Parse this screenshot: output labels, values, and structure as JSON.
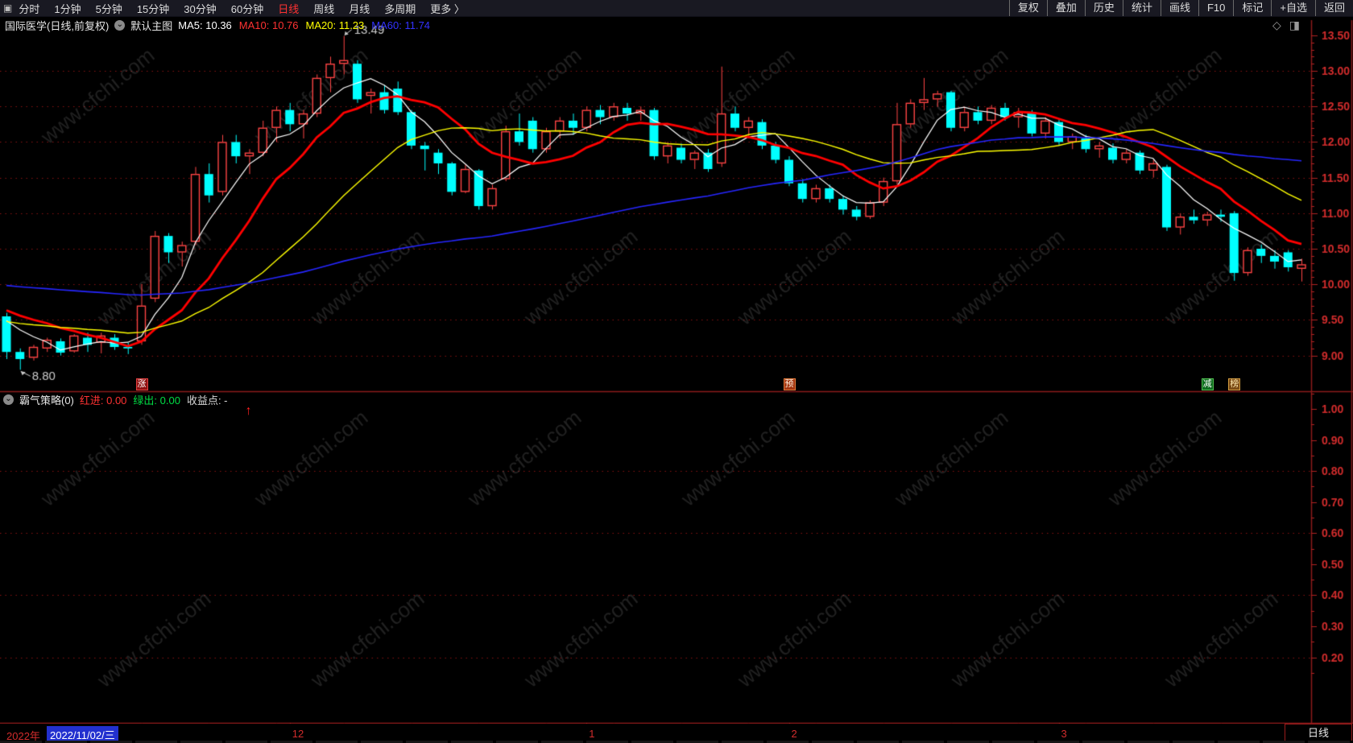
{
  "topbar": {
    "window_icon": "▣",
    "periods": [
      {
        "label": "分时",
        "active": false
      },
      {
        "label": "1分钟",
        "active": false
      },
      {
        "label": "5分钟",
        "active": false
      },
      {
        "label": "15分钟",
        "active": false
      },
      {
        "label": "30分钟",
        "active": false
      },
      {
        "label": "60分钟",
        "active": false
      },
      {
        "label": "日线",
        "active": true
      },
      {
        "label": "周线",
        "active": false
      },
      {
        "label": "月线",
        "active": false
      },
      {
        "label": "多周期",
        "active": false
      },
      {
        "label": "更多 〉",
        "active": false
      }
    ],
    "tools": [
      "复权",
      "叠加",
      "历史",
      "统计",
      "画线",
      "F10",
      "标记",
      "+自选",
      "返回"
    ]
  },
  "title_bar": {
    "stock": "国际医学(日线,前复权)",
    "toggle_icon": "⌄",
    "overlay_label": "默认主图",
    "ma_labels": [
      {
        "text": "MA5: 10.36",
        "color": "#ffffff"
      },
      {
        "text": "MA10: 10.76",
        "color": "#ff3232"
      },
      {
        "text": "MA20: 11.23",
        "color": "#ffff00"
      },
      {
        "text": "MA60: 11.74",
        "color": "#3232ff"
      }
    ],
    "diamond_icon": "◇",
    "split_icon": "◨"
  },
  "indicator_bar": {
    "toggle_icon": "⌄",
    "name": "霸气策略(0)",
    "items": [
      {
        "text": "红进: 0.00",
        "color": "#ff3232"
      },
      {
        "text": "绿出: 0.00",
        "color": "#00dd44"
      },
      {
        "text": "收益点: -",
        "color": "#d8d8d8"
      }
    ]
  },
  "chart_data": {
    "type": "candlestick",
    "title": "国际医学(日线,前复权)",
    "period": "日线",
    "watermark_text": "www.cfchi.com",
    "y_axis_main": {
      "ticks": [
        13.5,
        13.0,
        12.5,
        12.0,
        11.5,
        11.0,
        10.5,
        10.0,
        9.5,
        9.0
      ],
      "grid_lines": [
        13.0,
        12.5,
        12.0,
        11.5,
        11.0,
        10.5,
        10.0,
        9.5,
        9.0
      ]
    },
    "y_axis_sub": {
      "ticks": [
        1.0,
        0.9,
        0.8,
        0.7,
        0.6,
        0.5,
        0.4,
        0.3,
        0.2
      ],
      "grid_lines": [
        0.8,
        0.6,
        0.4,
        0.2
      ]
    },
    "x_axis": {
      "year_label": "2022年",
      "selected_date": "2022/11/02/三",
      "month_ticks": [
        {
          "label": "12",
          "index": 21
        },
        {
          "label": "1",
          "index": 43
        },
        {
          "label": "2",
          "index": 58
        },
        {
          "label": "3",
          "index": 78
        }
      ],
      "period_label": "日线"
    },
    "candles": [
      [
        9.55,
        9.6,
        8.95,
        9.05
      ],
      [
        9.05,
        9.1,
        8.8,
        8.95
      ],
      [
        8.97,
        9.15,
        8.93,
        9.12
      ],
      [
        9.1,
        9.25,
        9.05,
        9.22
      ],
      [
        9.2,
        9.24,
        9.0,
        9.04
      ],
      [
        9.06,
        9.3,
        9.04,
        9.28
      ],
      [
        9.25,
        9.32,
        9.05,
        9.15
      ],
      [
        9.18,
        9.32,
        9.03,
        9.28
      ],
      [
        9.25,
        9.3,
        9.08,
        9.12
      ],
      [
        9.12,
        9.18,
        9.02,
        9.1
      ],
      [
        9.2,
        10.0,
        9.15,
        9.7
      ],
      [
        9.8,
        10.75,
        9.75,
        10.68
      ],
      [
        10.68,
        10.72,
        10.3,
        10.45
      ],
      [
        10.45,
        10.6,
        10.25,
        10.55
      ],
      [
        10.6,
        11.65,
        10.55,
        11.55
      ],
      [
        11.55,
        11.7,
        11.15,
        11.25
      ],
      [
        11.3,
        12.1,
        11.25,
        12.0
      ],
      [
        12.0,
        12.1,
        11.7,
        11.8
      ],
      [
        11.8,
        11.9,
        11.55,
        11.85
      ],
      [
        11.85,
        12.3,
        11.8,
        12.2
      ],
      [
        12.2,
        12.5,
        12.0,
        12.45
      ],
      [
        12.45,
        12.55,
        12.15,
        12.25
      ],
      [
        12.25,
        12.45,
        12.05,
        12.4
      ],
      [
        12.4,
        12.95,
        12.35,
        12.9
      ],
      [
        12.9,
        13.2,
        12.7,
        13.1
      ],
      [
        13.1,
        13.49,
        12.95,
        13.15
      ],
      [
        13.1,
        13.15,
        12.55,
        12.6
      ],
      [
        12.65,
        12.75,
        12.4,
        12.7
      ],
      [
        12.7,
        12.8,
        12.4,
        12.45
      ],
      [
        12.75,
        12.85,
        12.38,
        12.42
      ],
      [
        12.42,
        12.45,
        11.9,
        11.95
      ],
      [
        11.95,
        12.0,
        11.6,
        11.9
      ],
      [
        11.85,
        11.9,
        11.55,
        11.7
      ],
      [
        11.7,
        11.72,
        11.25,
        11.3
      ],
      [
        11.3,
        11.68,
        11.28,
        11.62
      ],
      [
        11.6,
        11.62,
        11.05,
        11.1
      ],
      [
        11.1,
        11.4,
        11.05,
        11.35
      ],
      [
        11.48,
        12.23,
        11.45,
        12.15
      ],
      [
        12.15,
        12.4,
        11.95,
        12.0
      ],
      [
        12.3,
        12.35,
        11.85,
        11.9
      ],
      [
        11.9,
        12.2,
        11.85,
        12.15
      ],
      [
        12.15,
        12.35,
        12.05,
        12.3
      ],
      [
        12.3,
        12.4,
        12.1,
        12.2
      ],
      [
        12.2,
        12.5,
        12.15,
        12.45
      ],
      [
        12.45,
        12.52,
        12.25,
        12.35
      ],
      [
        12.35,
        12.55,
        12.3,
        12.5
      ],
      [
        12.48,
        12.55,
        12.3,
        12.4
      ],
      [
        12.4,
        12.5,
        12.3,
        12.45
      ],
      [
        12.45,
        12.48,
        11.75,
        11.8
      ],
      [
        11.8,
        12.0,
        11.7,
        11.95
      ],
      [
        11.92,
        11.98,
        11.7,
        11.75
      ],
      [
        11.75,
        11.88,
        11.62,
        11.85
      ],
      [
        11.85,
        11.9,
        11.58,
        11.62
      ],
      [
        11.7,
        13.06,
        11.65,
        12.4
      ],
      [
        12.4,
        12.5,
        12.15,
        12.2
      ],
      [
        12.2,
        12.35,
        12.05,
        12.3
      ],
      [
        12.28,
        12.32,
        11.9,
        11.95
      ],
      [
        11.95,
        12.0,
        11.7,
        11.75
      ],
      [
        11.75,
        11.8,
        11.38,
        11.42
      ],
      [
        11.42,
        11.48,
        11.15,
        11.2
      ],
      [
        11.2,
        11.4,
        11.15,
        11.35
      ],
      [
        11.35,
        11.4,
        11.15,
        11.2
      ],
      [
        11.2,
        11.25,
        10.98,
        11.05
      ],
      [
        11.05,
        11.1,
        10.9,
        10.95
      ],
      [
        10.95,
        11.18,
        10.92,
        11.15
      ],
      [
        11.15,
        11.5,
        11.1,
        11.45
      ],
      [
        11.45,
        12.55,
        11.4,
        12.25
      ],
      [
        12.25,
        12.6,
        12.2,
        12.55
      ],
      [
        12.55,
        12.9,
        12.45,
        12.6
      ],
      [
        12.6,
        12.72,
        12.5,
        12.68
      ],
      [
        12.7,
        12.72,
        12.15,
        12.2
      ],
      [
        12.2,
        12.48,
        12.15,
        12.42
      ],
      [
        12.42,
        12.5,
        12.25,
        12.3
      ],
      [
        12.3,
        12.52,
        12.25,
        12.48
      ],
      [
        12.48,
        12.55,
        12.3,
        12.35
      ],
      [
        12.35,
        12.48,
        12.2,
        12.42
      ],
      [
        12.42,
        12.45,
        12.08,
        12.12
      ],
      [
        12.12,
        12.35,
        12.05,
        12.3
      ],
      [
        12.28,
        12.32,
        11.95,
        12.0
      ],
      [
        12.0,
        12.12,
        11.9,
        12.08
      ],
      [
        12.05,
        12.1,
        11.85,
        11.9
      ],
      [
        11.9,
        12.0,
        11.78,
        11.95
      ],
      [
        11.92,
        11.98,
        11.7,
        11.75
      ],
      [
        11.75,
        11.9,
        11.7,
        11.85
      ],
      [
        11.85,
        11.88,
        11.55,
        11.6
      ],
      [
        11.6,
        11.75,
        11.5,
        11.7
      ],
      [
        11.65,
        11.68,
        10.75,
        10.8
      ],
      [
        10.8,
        11.0,
        10.7,
        10.95
      ],
      [
        10.95,
        11.05,
        10.85,
        10.9
      ],
      [
        10.9,
        11.02,
        10.82,
        10.98
      ],
      [
        10.98,
        11.05,
        10.88,
        10.95
      ],
      [
        11.0,
        11.03,
        10.05,
        10.16
      ],
      [
        10.16,
        10.52,
        10.12,
        10.48
      ],
      [
        10.5,
        10.56,
        10.3,
        10.4
      ],
      [
        10.4,
        10.48,
        10.22,
        10.32
      ],
      [
        10.45,
        10.48,
        10.18,
        10.24
      ],
      [
        10.22,
        10.36,
        10.04,
        10.28
      ]
    ],
    "ma_lines": [
      {
        "name": "MA5",
        "color": "#ffffff",
        "period": 5,
        "seed": 9.6,
        "width": 1.2
      },
      {
        "name": "MA10",
        "color": "#ff0000",
        "period": 10,
        "seed": 9.7,
        "width": 2.8
      },
      {
        "name": "MA20",
        "color": "#ffff00",
        "period": 20,
        "seed": 9.5,
        "width": 1.4
      },
      {
        "name": "MA60",
        "color": "#2626ff",
        "period": 60,
        "seed": 10.0,
        "width": 1.6
      }
    ],
    "annotations": [
      {
        "type": "high",
        "text": "13.49",
        "index": 25,
        "value": 13.49
      },
      {
        "type": "low",
        "text": "8.80",
        "index": 1,
        "value": 8.8
      }
    ],
    "event_badges": [
      {
        "text": "涨",
        "index": 10,
        "bg": "#8f1010",
        "border": "#e04040",
        "fg": "#ffffff"
      },
      {
        "text": "预",
        "index": 58,
        "bg": "#a33510",
        "border": "#e07a3a",
        "fg": "#fff2e0"
      },
      {
        "text": "减",
        "index": 89,
        "bg": "#0f6b1f",
        "border": "#4fc04f",
        "fg": "#ffffff"
      },
      {
        "text": "榜",
        "index": 91,
        "bg": "#7a4a14",
        "border": "#cf9a40",
        "fg": "#ffe9b0"
      }
    ],
    "signal_arrow": {
      "symbol": "↑",
      "index": 18,
      "color": "#ff2020"
    },
    "colors": {
      "up": "#ff4444",
      "down": "#00ffff",
      "axis": "#8b1a1a",
      "grid": "#8a1212",
      "label": "#d22c2c",
      "watermark": "rgba(150,150,150,0.22)"
    }
  }
}
